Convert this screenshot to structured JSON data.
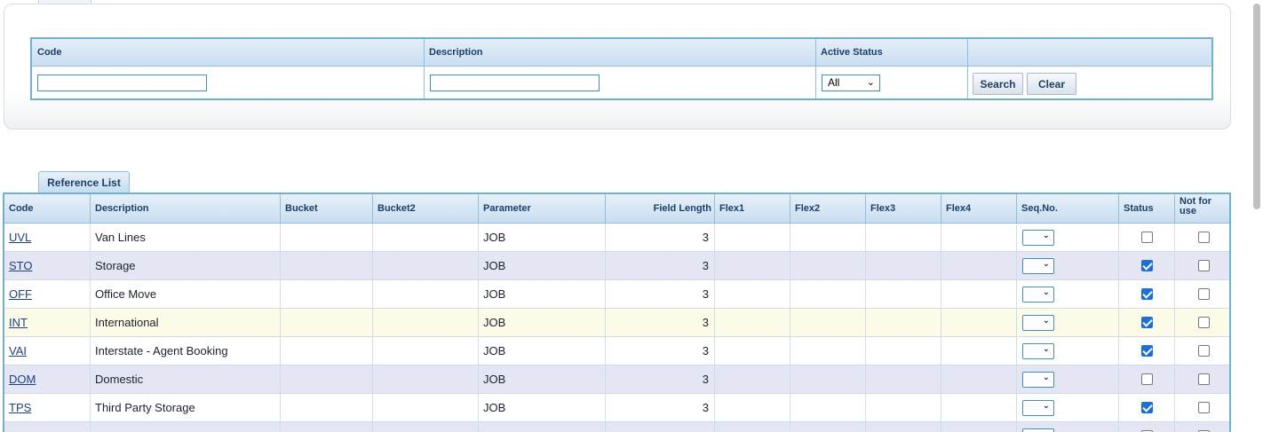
{
  "search": {
    "headers": {
      "code": "Code",
      "description": "Description",
      "active_status": "Active Status"
    },
    "code_value": "",
    "description_value": "",
    "active_status_selected": "All",
    "search_label": "Search",
    "clear_label": "Clear"
  },
  "reference_list": {
    "tab_label": "Reference List",
    "columns": {
      "code": "Code",
      "description": "Description",
      "bucket": "Bucket",
      "bucket2": "Bucket2",
      "parameter": "Parameter",
      "field_length": "Field Length",
      "flex1": "Flex1",
      "flex2": "Flex2",
      "flex3": "Flex3",
      "flex4": "Flex4",
      "seq_no": "Seq.No.",
      "status": "Status",
      "not_for_use": "Not for use"
    },
    "rows": [
      {
        "code": "UVL",
        "description": "Van Lines",
        "bucket": "",
        "bucket2": "",
        "parameter": "JOB",
        "field_length": "3",
        "flex1": "",
        "flex2": "",
        "flex3": "",
        "flex4": "",
        "seq_no": "",
        "status": false,
        "not_for_use": false
      },
      {
        "code": "STO",
        "description": "Storage",
        "bucket": "",
        "bucket2": "",
        "parameter": "JOB",
        "field_length": "3",
        "flex1": "",
        "flex2": "",
        "flex3": "",
        "flex4": "",
        "seq_no": "",
        "status": true,
        "not_for_use": false
      },
      {
        "code": "OFF",
        "description": "Office Move",
        "bucket": "",
        "bucket2": "",
        "parameter": "JOB",
        "field_length": "3",
        "flex1": "",
        "flex2": "",
        "flex3": "",
        "flex4": "",
        "seq_no": "",
        "status": true,
        "not_for_use": false
      },
      {
        "code": "INT",
        "description": "International",
        "bucket": "",
        "bucket2": "",
        "parameter": "JOB",
        "field_length": "3",
        "flex1": "",
        "flex2": "",
        "flex3": "",
        "flex4": "",
        "seq_no": "",
        "status": true,
        "not_for_use": false
      },
      {
        "code": "VAI",
        "description": "Interstate - Agent Booking",
        "bucket": "",
        "bucket2": "",
        "parameter": "JOB",
        "field_length": "3",
        "flex1": "",
        "flex2": "",
        "flex3": "",
        "flex4": "",
        "seq_no": "",
        "status": true,
        "not_for_use": false
      },
      {
        "code": "DOM",
        "description": "Domestic",
        "bucket": "",
        "bucket2": "",
        "parameter": "JOB",
        "field_length": "3",
        "flex1": "",
        "flex2": "",
        "flex3": "",
        "flex4": "",
        "seq_no": "",
        "status": false,
        "not_for_use": false
      },
      {
        "code": "TPS",
        "description": "Third Party Storage",
        "bucket": "",
        "bucket2": "",
        "parameter": "JOB",
        "field_length": "3",
        "flex1": "",
        "flex2": "",
        "flex3": "",
        "flex4": "",
        "seq_no": "",
        "status": true,
        "not_for_use": false
      },
      {
        "code": "",
        "description": "",
        "bucket": "",
        "bucket2": "",
        "parameter": "",
        "field_length": "",
        "flex1": "",
        "flex2": "",
        "flex3": "",
        "flex4": "",
        "seq_no": "",
        "status": false,
        "not_for_use": false
      }
    ],
    "highlighted_row": 3
  },
  "colors": {
    "grid_border": "#6fb1d6",
    "header_text": "#1a3f6b",
    "row_alt": "#e4e6f3",
    "row_highlight": "#fbfbe8",
    "checkbox_on": "#1a6fe0"
  },
  "icons": {
    "select_chevron": "chevron-down-icon",
    "checkbox_checked": "checkmark-icon"
  }
}
